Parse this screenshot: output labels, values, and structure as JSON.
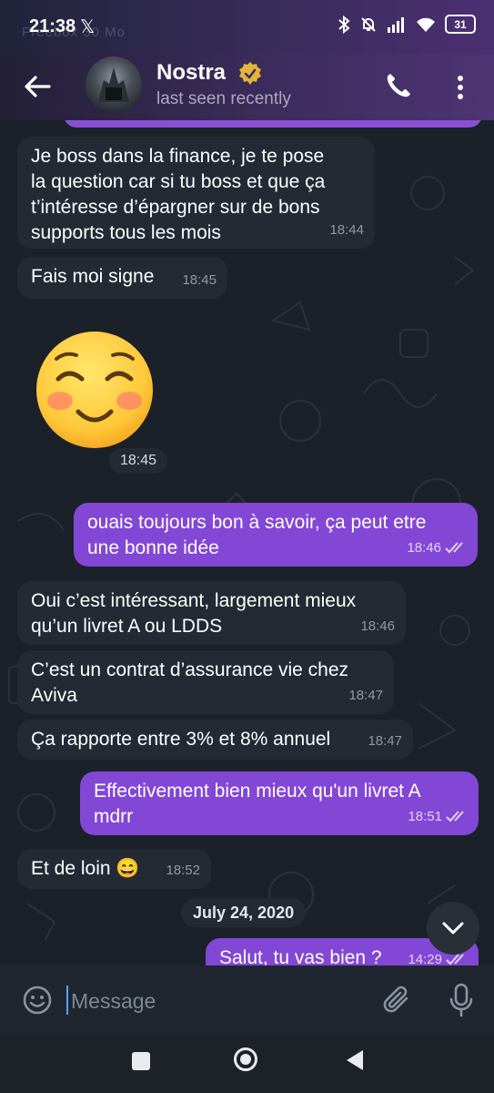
{
  "status_bar": {
    "time": "21:38",
    "ghost_text": "Freebox 30 Mo",
    "battery": "31"
  },
  "header": {
    "contact_name": "Nostra",
    "status": "last seen recently"
  },
  "messages": [
    {
      "text": "Je boss dans la finance, je te pose\nla question car si tu boss et que ça\nt’intéresse d’épargner sur de bons\nsupports tous les mois",
      "time": "18:44"
    },
    {
      "text": "Fais moi signe",
      "time": "18:45"
    },
    {
      "sticker": "smiling-blushing-face",
      "time": "18:45"
    },
    {
      "text": "ouais toujours bon à savoir, ça peut etre\nune bonne idée",
      "time": "18:46"
    },
    {
      "text": "Oui c’est intéressant, largement mieux\nqu’un livret A ou LDDS",
      "time": "18:46"
    },
    {
      "text": "C’est un contrat d’assurance vie chez\nAviva",
      "time": "18:47"
    },
    {
      "text": "Ça rapporte entre 3% et 8% annuel",
      "time": "18:47"
    },
    {
      "text": "Effectivement bien mieux qu'un livret A\nmdrr",
      "time": "18:51"
    },
    {
      "text": "Et de loin 😄",
      "time": "18:52"
    },
    {
      "text": "Salut, tu vas bien ?",
      "time": "14:29"
    }
  ],
  "date_separator": "July 24, 2020",
  "input": {
    "placeholder": "Message"
  },
  "colors": {
    "incoming_bubble": "#232a33",
    "outgoing_bubble": "#8347d6",
    "header_accent": "#4e3474",
    "background": "#1b2129"
  },
  "icons": [
    "back-arrow-icon",
    "verified-badge-icon",
    "phone-icon",
    "more-vert-icon",
    "double-check-icon",
    "chevron-down-icon",
    "emoji-icon",
    "attach-icon",
    "mic-icon"
  ]
}
